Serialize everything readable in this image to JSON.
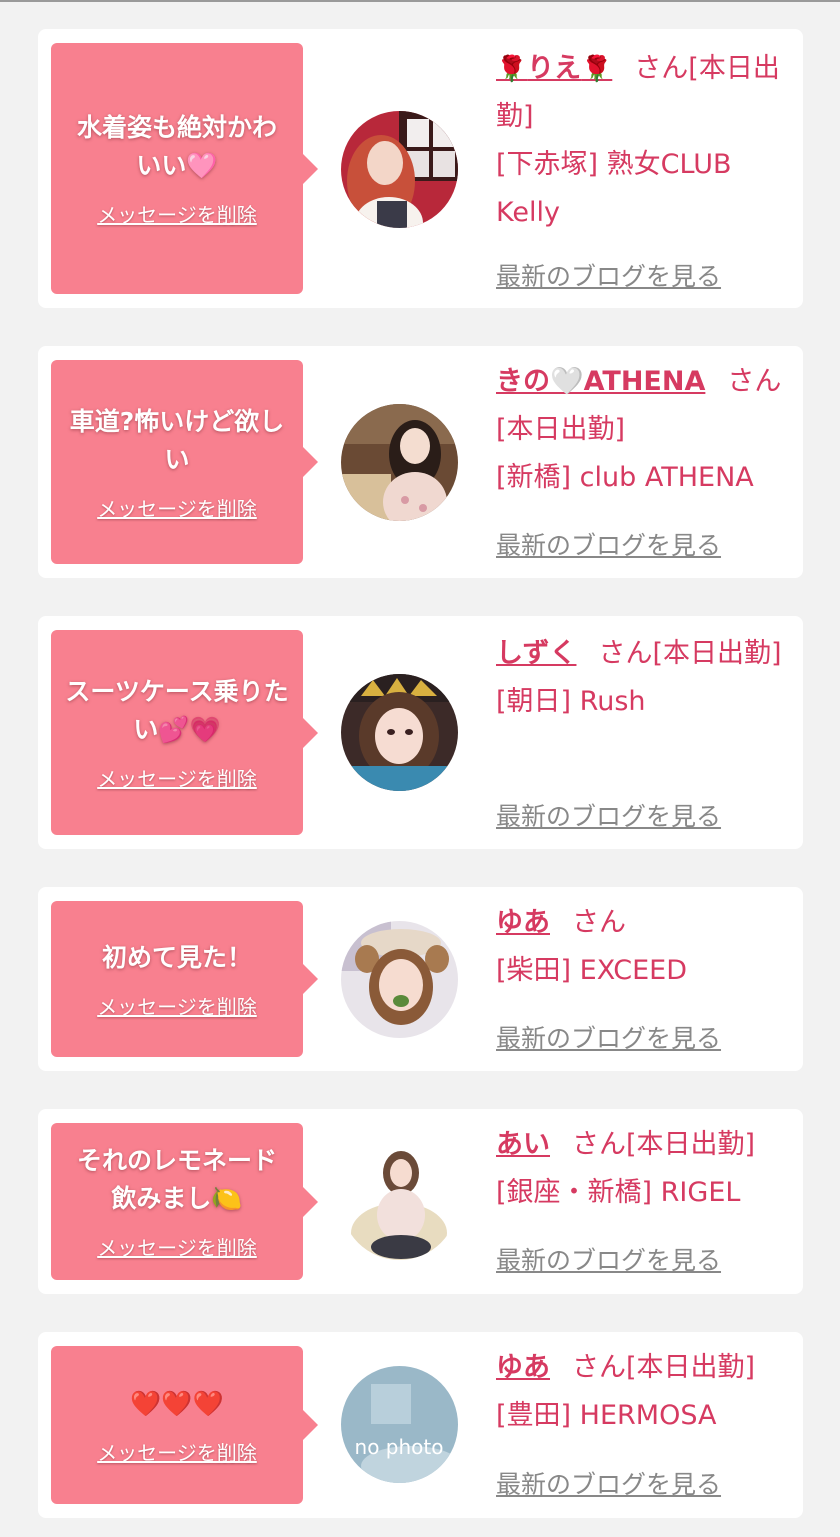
{
  "common": {
    "delete_label": "メッセージを削除",
    "blog_label": "最新のブログを見る",
    "san": "さん"
  },
  "cards": [
    {
      "message": "水着姿も絶対かわいい🩷",
      "name": "🌹りえ🌹",
      "name_text": "りえ",
      "status": "[本日出勤]",
      "area": "[下赤塚]",
      "shop": "熟女CLUB Kelly"
    },
    {
      "message": "車道?怖いけど欲しい",
      "name": "きの🤍ATHENA",
      "status": "[本日出勤]",
      "area": "[新橋]",
      "shop": "club ATHENA"
    },
    {
      "message": "スーツケース乗りたい💕💗",
      "name": "しずく",
      "status": "[本日出勤]",
      "area": "[朝日]",
      "shop": "Rush"
    },
    {
      "message": "初めて見た！",
      "name": "ゆあ",
      "status": "",
      "area": "[柴田]",
      "shop": "EXCEED"
    },
    {
      "message": "それのレモネード飲みまし🍋",
      "name": "あい",
      "status": "[本日出勤]",
      "area": "[銀座・新橋]",
      "shop": "RIGEL"
    },
    {
      "message": "❤️❤️❤️",
      "name": "ゆあ",
      "status": "[本日出勤]",
      "area": "[豊田]",
      "shop": "HERMOSA"
    }
  ],
  "no_photo_text": "no photo",
  "colors": {
    "bubble": "#f8808f",
    "accent": "#d63a61",
    "link_gray": "#888888",
    "background": "#f2f2f2"
  }
}
